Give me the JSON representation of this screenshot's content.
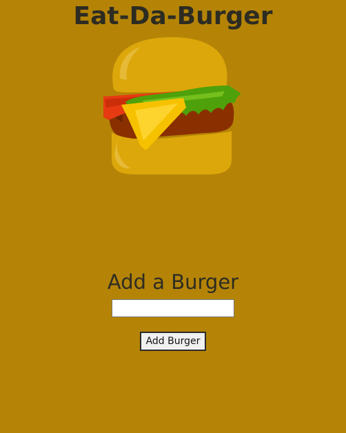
{
  "header": {
    "title": "Eat-Da-Burger"
  },
  "logo": {
    "icon": "burger-icon"
  },
  "form": {
    "heading": "Add a Burger",
    "input_value": "",
    "input_placeholder": "",
    "submit_label": "Add Burger"
  },
  "colors": {
    "background": "#b58407",
    "bun": "#dca70a",
    "patty": "#8a3000",
    "tomato": "#e63a12",
    "lettuce": "#4ea10a",
    "cheese": "#f6c200"
  }
}
